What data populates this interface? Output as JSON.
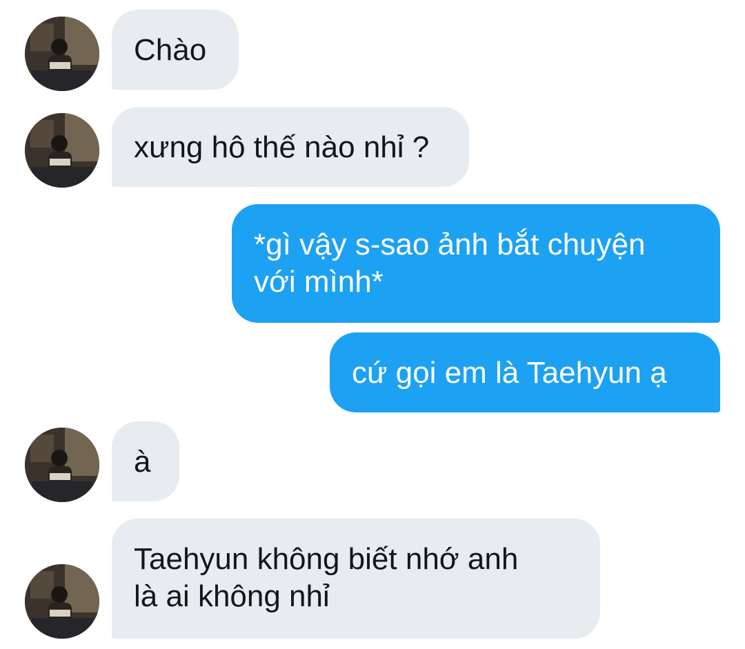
{
  "conversation": {
    "messages": [
      {
        "sender": "other",
        "text": "Chào"
      },
      {
        "sender": "other",
        "text": "xưng hô thế nào nhỉ ?"
      },
      {
        "sender": "me",
        "text": "*gì vậy s-sao ảnh bắt chuyện\nvới mình*"
      },
      {
        "sender": "me",
        "text": "cứ gọi em là Taehyun ạ"
      },
      {
        "sender": "other",
        "text": "à"
      },
      {
        "sender": "other",
        "text": "Taehyun không biết nhớ anh\nlà ai không nhỉ"
      }
    ]
  },
  "colors": {
    "incoming_bubble": "#e6ecf0",
    "outgoing_bubble": "#1da1f2",
    "incoming_text": "#14171a",
    "outgoing_text": "#ffffff"
  },
  "icons": {
    "avatar": "user-photo-avatar"
  }
}
